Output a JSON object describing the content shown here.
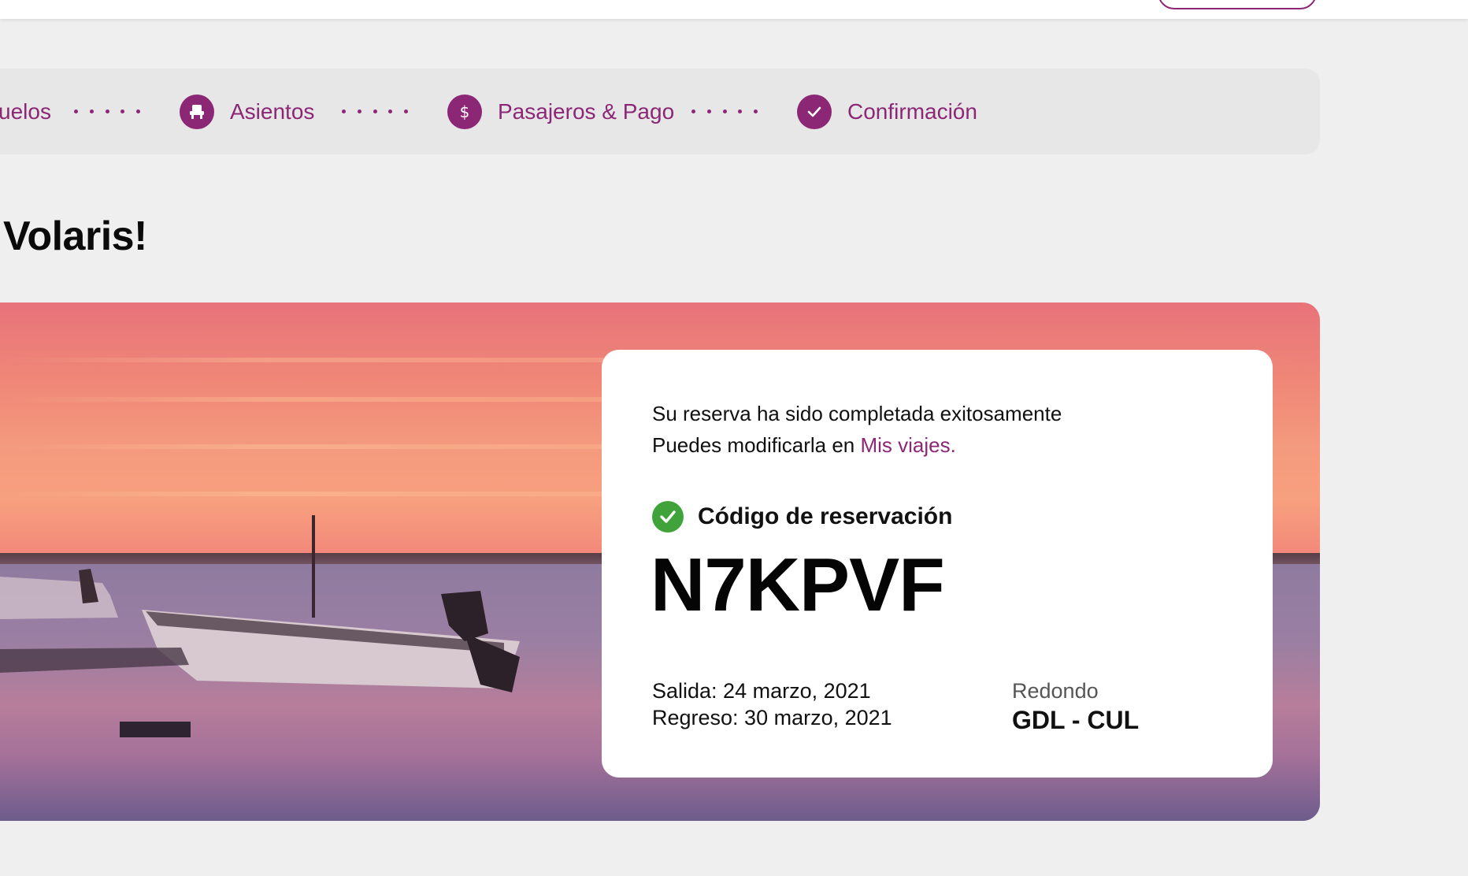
{
  "colors": {
    "brand": "#8c2776",
    "success": "#3fa33a",
    "page_bg": "#efefef"
  },
  "stepper": {
    "steps": [
      {
        "label": "uelos",
        "icon": "plane-icon"
      },
      {
        "label": "Asientos",
        "icon": "seat-icon"
      },
      {
        "label": "Pasajeros & Pago",
        "icon": "dollar-icon"
      },
      {
        "label": "Confirmación",
        "icon": "check-icon"
      }
    ]
  },
  "welcome": {
    "title": "Volaris!"
  },
  "confirmation": {
    "message_line1": "Su reserva ha sido completada exitosamente",
    "message_line2_prefix": "Puedes modificarla en ",
    "message_link": "Mis viajes.",
    "code_label": "Código de reservación",
    "code_value": "N7KPVF",
    "departure": "Salida: 24 marzo, 2021",
    "return": "Regreso: 30 marzo, 2021",
    "trip_type": "Redondo",
    "route": "GDL - CUL"
  }
}
